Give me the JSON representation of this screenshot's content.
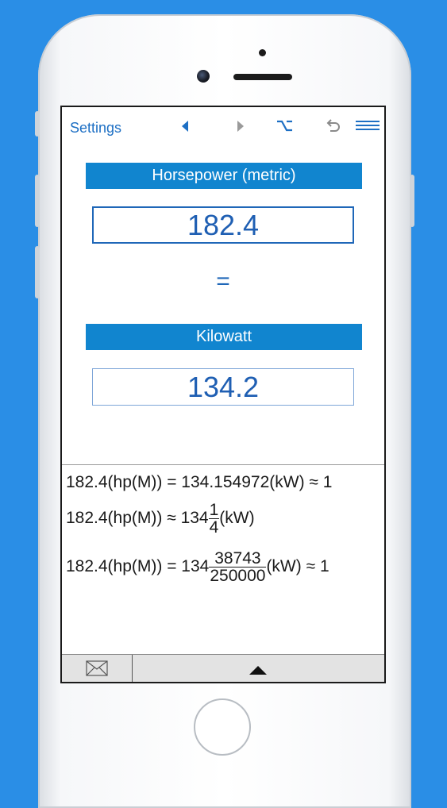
{
  "toolbar": {
    "settings_label": "Settings",
    "icons": [
      "back-arrow-icon",
      "forward-arrow-icon",
      "option-key-icon",
      "undo-icon",
      "menu-icon"
    ]
  },
  "converter": {
    "from_unit": "Horsepower (metric)",
    "from_value": "182.4",
    "equals": "=",
    "to_unit": "Kilowatt",
    "to_value": "134.2"
  },
  "results": {
    "line1": "182.4(hp(M)) = 134.154972(kW) ≈ 1",
    "line2_prefix": "182.4(hp(M)) ≈ 134",
    "line2_num": "1",
    "line2_den": "4",
    "line2_suffix": "(kW)",
    "line3_prefix": "182.4(hp(M)) = 134",
    "line3_num": "38743",
    "line3_den": "250000",
    "line3_suffix": "(kW) ≈ 1"
  },
  "bottom": {
    "icons": [
      "mail-icon",
      "expand-up-icon"
    ]
  },
  "colors": {
    "background": "#2a8ee6",
    "header_bar": "#1185cf",
    "accent_text": "#1f5fb3"
  }
}
